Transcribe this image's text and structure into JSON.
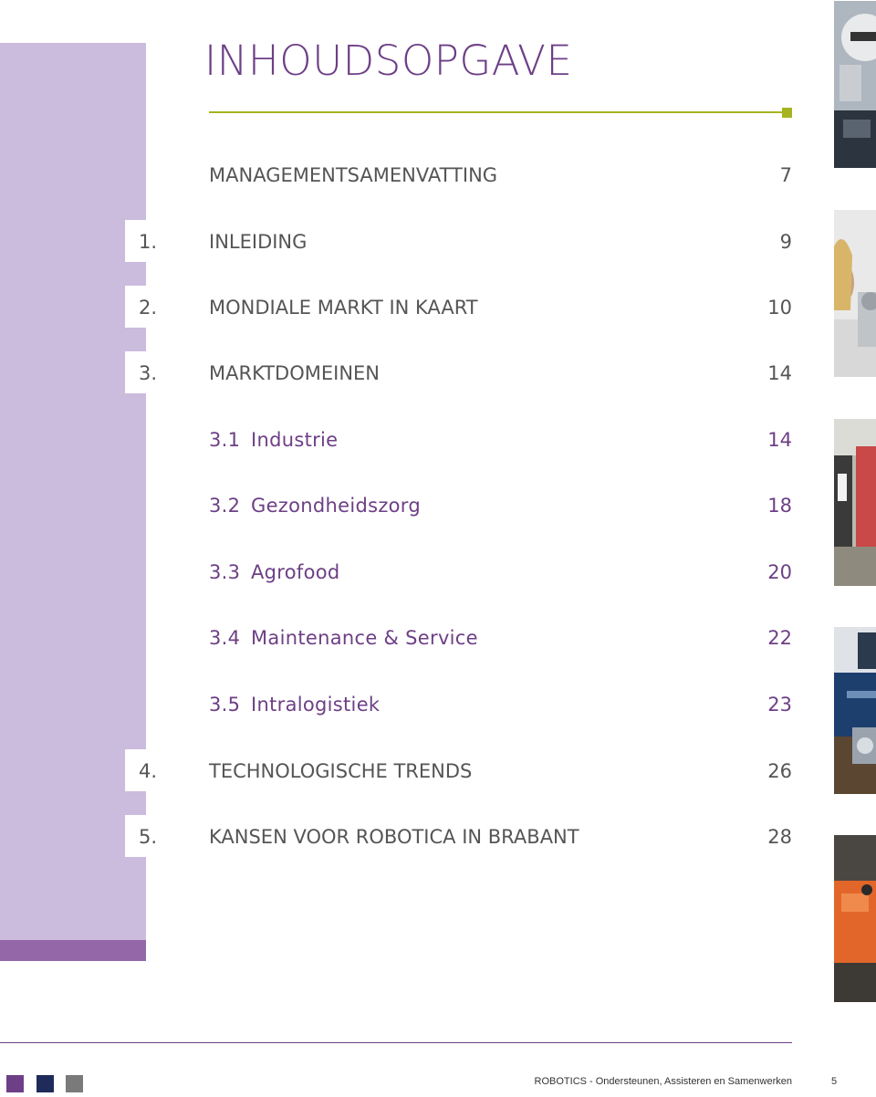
{
  "title": "INHOUDSOPGAVE",
  "toc": [
    {
      "num": "",
      "label": "MANAGEMENTSAMENVATTING",
      "page": "7"
    },
    {
      "num": "1.",
      "label": "INLEIDING",
      "page": "9"
    },
    {
      "num": "2.",
      "label": "MONDIALE MARKT IN KAART",
      "page": "10"
    },
    {
      "num": "3.",
      "label": "MARKTDOMEINEN",
      "page": "14"
    },
    {
      "num": "3.1",
      "label": "Industrie",
      "page": "14"
    },
    {
      "num": "3.2",
      "label": "Gezondheidszorg",
      "page": "18"
    },
    {
      "num": "3.3",
      "label": "Agrofood",
      "page": "20"
    },
    {
      "num": "3.4",
      "label": "Maintenance & Service",
      "page": "22"
    },
    {
      "num": "3.5",
      "label": "Intralogistiek",
      "page": "23"
    },
    {
      "num": "4.",
      "label": "TECHNOLOGISCHE TRENDS",
      "page": "26"
    },
    {
      "num": "5.",
      "label": "KANSEN VOOR ROBOTICA IN BRABANT",
      "page": "28"
    }
  ],
  "footer": {
    "text": "ROBOTICS - Ondersteunen, Assisteren en Samenwerken",
    "page_number": "5"
  },
  "colors": {
    "purple": "#6d3f86",
    "lilac": "#cbbbdc",
    "accent_green": "#a5b320",
    "navy": "#1f2b5a",
    "grey": "#7a7a7a"
  },
  "icons": [
    "industrial-robot-photo",
    "healthcare-robot-photo",
    "milking-robot-photo",
    "inspection-robot-photo",
    "logistics-robot-photo"
  ]
}
